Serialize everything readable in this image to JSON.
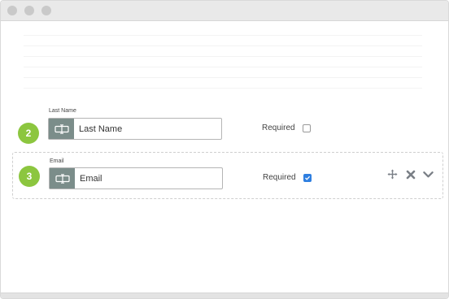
{
  "window": {
    "controls": [
      "close",
      "minimize",
      "maximize"
    ]
  },
  "fields": [
    {
      "number": "2",
      "caption": "Last Name",
      "value": "Last Name",
      "required_label": "Required",
      "required": false,
      "selected": false,
      "icon": "text-field-icon"
    },
    {
      "number": "3",
      "caption": "Email",
      "value": "Email",
      "required_label": "Required",
      "required": true,
      "selected": true,
      "icon": "text-field-icon",
      "actions": [
        "move-icon",
        "delete-icon",
        "chevron-down-icon"
      ]
    }
  ],
  "colors": {
    "badge": "#8cc63f",
    "input_icon_bg": "#7b8d8a",
    "checkbox_checked": "#2f7fe0",
    "action_icons": "#7a7f86"
  }
}
